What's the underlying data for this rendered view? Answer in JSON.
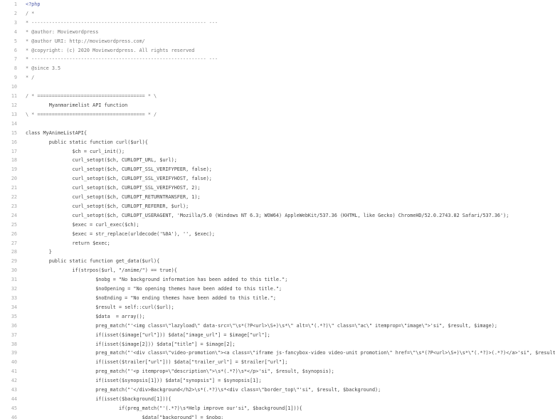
{
  "editor": {
    "language": "php",
    "colors": {
      "background": "#ffffff",
      "line_number": "#a8a8a8",
      "text": "#444444",
      "keyword": "#c0392b",
      "variable": "#2a6cb3",
      "comment": "#7a7a7a"
    },
    "lines": [
      {
        "n": "1",
        "text": "<?php"
      },
      {
        "n": "2",
        "text": "/ *"
      },
      {
        "n": "3",
        "text": "* ------------------------------------------------------------ ---"
      },
      {
        "n": "4",
        "text": "* @author: Moviewordpress"
      },
      {
        "n": "5",
        "text": "* @author URI: http://moviewordpress.com/"
      },
      {
        "n": "6",
        "text": "* @copyright: (c) 2020 Moviewordpress. All rights reserved"
      },
      {
        "n": "7",
        "text": "* ------------------------------------------------------------ ---"
      },
      {
        "n": "8",
        "text": "* @since 3.5"
      },
      {
        "n": "9",
        "text": "* /"
      },
      {
        "n": "10",
        "text": ""
      },
      {
        "n": "11",
        "text": "/ * ===================================== * \\"
      },
      {
        "n": "12",
        "text": "        Myanmarimelist API function"
      },
      {
        "n": "13",
        "text": "\\ * ===================================== * /"
      },
      {
        "n": "14",
        "text": ""
      },
      {
        "n": "15",
        "text": "class MyAnimeListAPI{"
      },
      {
        "n": "16",
        "text": "        public static function curl($url){"
      },
      {
        "n": "17",
        "text": "                $ch = curl_init();"
      },
      {
        "n": "18",
        "text": "                curl_setopt($ch, CURLOPT_URL, $url);"
      },
      {
        "n": "19",
        "text": "                curl_setopt($ch, CURLOPT_SSL_VERIFYPEER, false);"
      },
      {
        "n": "20",
        "text": "                curl_setopt($ch, CURLOPT_SSL_VERIFYHOST, false);"
      },
      {
        "n": "21",
        "text": "                curl_setopt($ch, CURLOPT_SSL_VERIFYHOST, 2);"
      },
      {
        "n": "22",
        "text": "                curl_setopt($ch, CURLOPT_RETURNTRANSFER, 1);"
      },
      {
        "n": "23",
        "text": "                curl_setopt($ch, CURLOPT_REFERER, $url);"
      },
      {
        "n": "24",
        "text": "                curl_setopt($ch, CURLOPT_USERAGENT, 'Mozilla/5.0 (Windows NT 6.3; WOW64) AppleWebKit/537.36 (KHTML, like Gecko) ChromeHD/52.0.2743.82 Safari/537.36');"
      },
      {
        "n": "25",
        "text": "                $exec = curl_exec($ch);"
      },
      {
        "n": "26",
        "text": "                $exec = str_replace(urldecode('%0A'), '', $exec);"
      },
      {
        "n": "27",
        "text": "                return $exec;"
      },
      {
        "n": "28",
        "text": "        }"
      },
      {
        "n": "29",
        "text": "        public static function get_data($url){"
      },
      {
        "n": "30",
        "text": "                if(strpos($url, \"/anime/\") == true){"
      },
      {
        "n": "31",
        "text": "                        $nobg = \"No background information has been added to this title.\";"
      },
      {
        "n": "32",
        "text": "                        $noOpening = \"No opening themes have been added to this title.\";"
      },
      {
        "n": "33",
        "text": "                        $noEnding = \"No ending themes have been added to this title.\";"
      },
      {
        "n": "34",
        "text": "                        $result = self::curl($url);"
      },
      {
        "n": "35",
        "text": "                        $data  = array();"
      },
      {
        "n": "36",
        "text": "                        preg_match(\"'<img class=\\\"lazyload\\\" data-src=\\\"\\s*(?P<url>\\S+)\\s*\\\" alt=\\\"(.*?)\\\" class=\\\"ac\\\" itemprop=\\\"image\\\">'si\", $result, $image);"
      },
      {
        "n": "37",
        "text": "                        if(isset($image[\"url\"])) $data[\"image_url\"] = $image[\"url\"];"
      },
      {
        "n": "38",
        "text": "                        if(isset($image[2])) $data[\"title\"] = $image[2];"
      },
      {
        "n": "39",
        "text": "                        preg_match(\"'<div class=\\\"video-promotion\\\"><a class=\\\"iframe js-fancybox-video video-unit promotion\\\" href=\\\"\\s*(?P<url>\\S+)\\s*\\\"(.*?)>(.*?)</a>'si\", $result, $trailer);"
      },
      {
        "n": "40",
        "text": "                        if(isset($trailer[\"url\"])) $data[\"trailer_url\"] = $trailer[\"url\"];"
      },
      {
        "n": "41",
        "text": "                        preg_match(\"'<p itemprop=\\\"description\\\">\\s*(.*?)\\s*</p>'si\", $result, $synopsis);"
      },
      {
        "n": "42",
        "text": "                        if(isset($synopsis[1])) $data[\"synopsis\"] = $synopsis[1];"
      },
      {
        "n": "43",
        "text": "                        preg_match(\"'</div>Background</h2>\\s*(.*?)\\s*<div class=\\\"border_top\\\"'si\", $result, $background);"
      },
      {
        "n": "44",
        "text": "                        if(isset($background[1])){"
      },
      {
        "n": "45",
        "text": "                                if(preg_match(\"'(.*?)\\s*Help improve our'si\", $background[1])){"
      },
      {
        "n": "46",
        "text": "                                        $data[\"background\"] = $nobg;"
      }
    ]
  }
}
